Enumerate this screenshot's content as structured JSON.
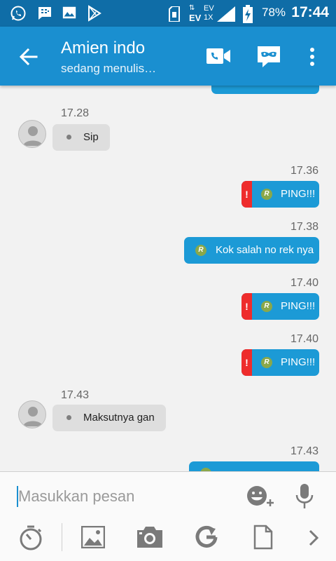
{
  "status_bar": {
    "battery_percent": "78%",
    "network_top": "EV",
    "network_bottom": "1X",
    "clock": "17:44"
  },
  "header": {
    "contact_name": "Amien indo",
    "status": "sedang menulis…"
  },
  "messages": [
    {
      "direction": "out",
      "time": "",
      "text": "",
      "partial": true
    },
    {
      "direction": "in",
      "time": "17.28",
      "text": "Sip"
    },
    {
      "direction": "out",
      "time": "17.36",
      "text": "PING!!!",
      "error": true
    },
    {
      "direction": "out",
      "time": "17.38",
      "text": "Kok salah no rek nya",
      "error": false
    },
    {
      "direction": "out",
      "time": "17.40",
      "text": "PING!!!",
      "error": true
    },
    {
      "direction": "out",
      "time": "17.40",
      "text": "PING!!!",
      "error": true
    },
    {
      "direction": "in",
      "time": "17.43",
      "text": "Maksutnya gan"
    },
    {
      "direction": "out",
      "time": "17.43",
      "text": "",
      "partial": true
    }
  ],
  "badges": {
    "read_marker": "R",
    "error_marker": "!"
  },
  "composer": {
    "placeholder": "Masukkan pesan"
  },
  "colors": {
    "status_bar": "#0f6da7",
    "app_bar": "#1a8fd0",
    "outgoing_bubble": "#1c9ad6",
    "incoming_bubble": "#dedede",
    "error": "#ee2c2c"
  },
  "icons": {
    "status_left": [
      "whatsapp-icon",
      "bbm-icon",
      "gallery-icon",
      "play-store-icon"
    ],
    "status_right": [
      "sim-icon",
      "signal-icon",
      "battery-charging-icon"
    ],
    "app_bar": [
      "back-arrow-icon",
      "video-call-icon",
      "incognito-mask-icon",
      "more-vert-icon"
    ],
    "composer": [
      "emoji-add-icon",
      "microphone-icon"
    ],
    "toolbar": [
      "timer-icon",
      "image-icon",
      "camera-icon",
      "gif-refresh-icon",
      "file-icon",
      "chevron-right-icon"
    ]
  }
}
